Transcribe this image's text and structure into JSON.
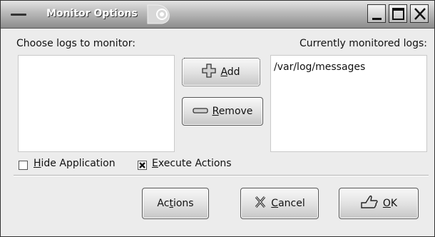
{
  "window": {
    "title": "Monitor Options"
  },
  "left_panel": {
    "label": "Choose logs to monitor:",
    "items": []
  },
  "right_panel": {
    "label": "Currently monitored logs:",
    "items": [
      "/var/log/messages"
    ]
  },
  "buttons": {
    "add": {
      "label_mnemonic": "A",
      "label_rest": "dd"
    },
    "remove": {
      "label_mnemonic": "R",
      "label_rest": "emove"
    },
    "actions": {
      "label_pre": "Ac",
      "label_mnemonic": "t",
      "label_post": "ions"
    },
    "cancel": {
      "label_mnemonic": "C",
      "label_rest": "ancel"
    },
    "ok": {
      "label_mnemonic": "O",
      "label_rest": "K"
    }
  },
  "options": {
    "hide_application": {
      "label_mnemonic": "H",
      "label_rest": "ide Application",
      "checked": false
    },
    "execute_actions": {
      "label_mnemonic": "E",
      "label_rest": "xecute Actions",
      "checked": true
    }
  },
  "icons": {
    "window_menu": "window-menu-icon",
    "app": "app-logo-icon",
    "minimize": "minimize-icon",
    "maximize": "maximize-icon",
    "close": "close-icon",
    "add": "plus-icon",
    "remove": "minus-icon",
    "cancel": "cross-icon",
    "ok": "hand-ok-icon"
  }
}
